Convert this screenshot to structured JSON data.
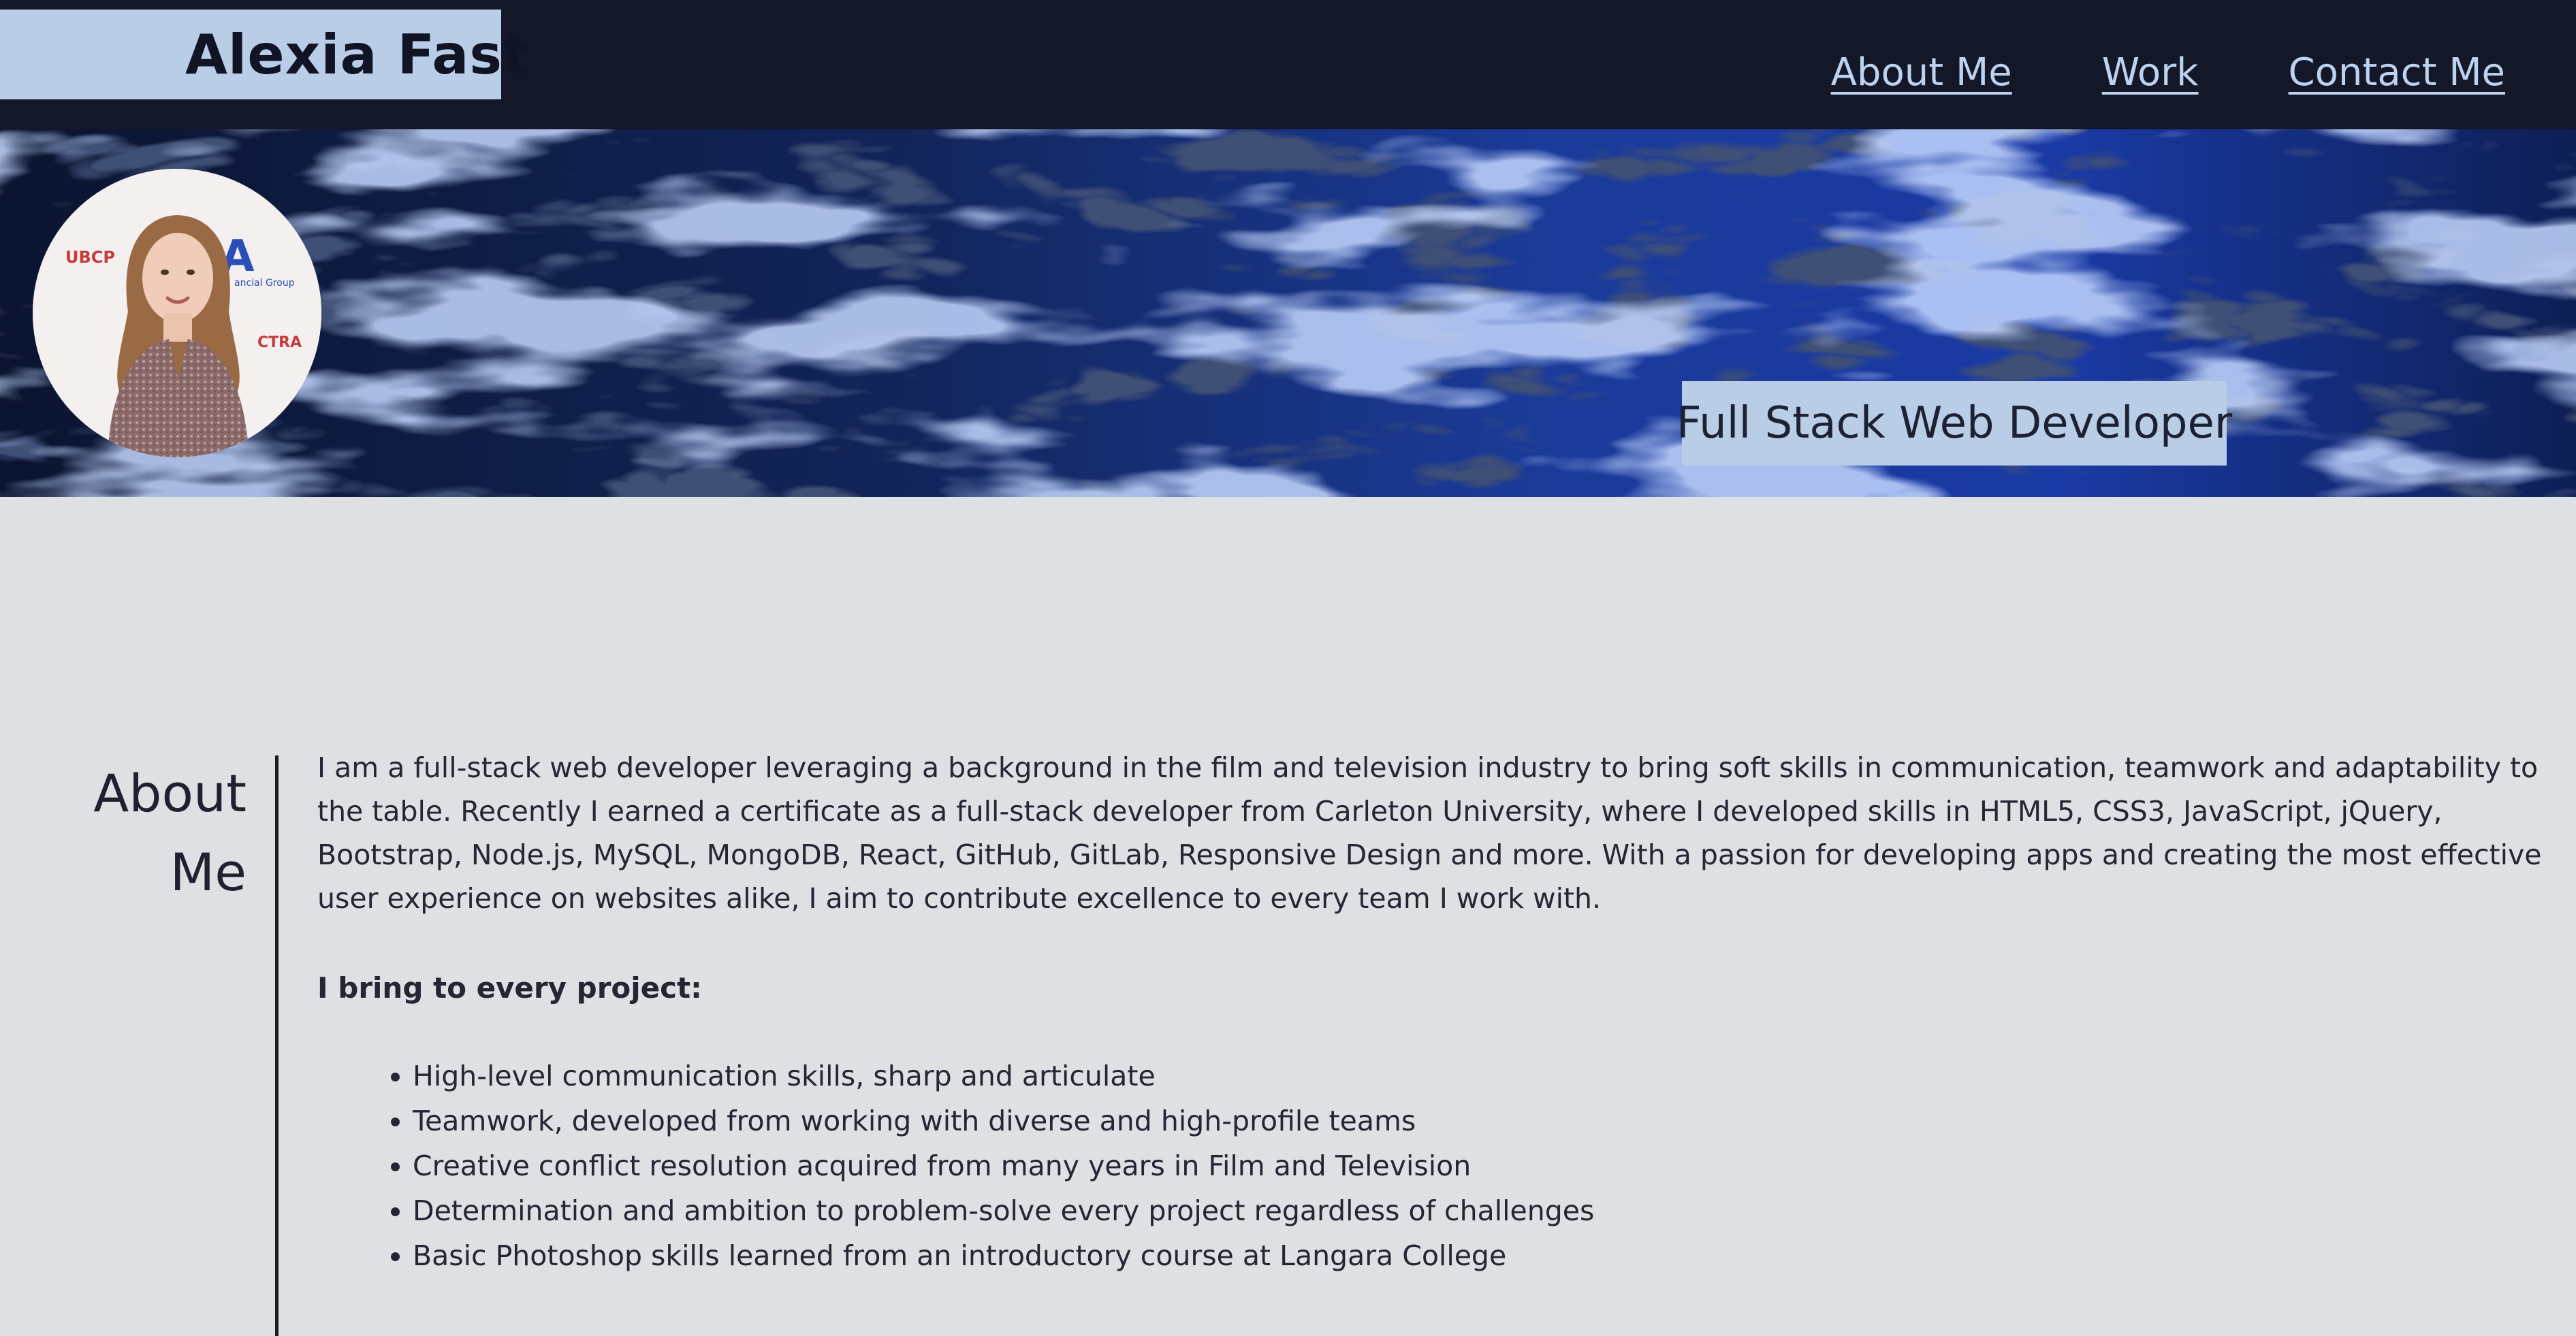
{
  "header": {
    "brand": "Alexia Fast",
    "nav": [
      {
        "label": "About Me"
      },
      {
        "label": "Work"
      },
      {
        "label": "Contact Me"
      }
    ]
  },
  "hero": {
    "tagline": "Full Stack Web Developer",
    "avatar_backdrop": [
      "UBCP",
      "A",
      "ancial Group",
      "CTRA"
    ]
  },
  "about": {
    "heading_line1": "About",
    "heading_line2": "Me",
    "paragraph": "I am a full-stack web developer leveraging a background in the film and television industry to bring soft skills in communication, teamwork and adaptability to the table. Recently I earned a certificate as a full-stack developer from Carleton University, where I developed skills in HTML5, CSS3, JavaScript, jQuery, Bootstrap, Node.js, MySQL, MongoDB, React, GitHub, GitLab, Responsive Design and more. With a passion for developing apps and creating the most effective user experience on websites alike, I aim to contribute excellence to every team I work with.",
    "bring_heading": "I bring to every project:",
    "bring_items": [
      "High-level communication skills, sharp and articulate",
      "Teamwork, developed from working with diverse and high-profile teams",
      "Creative conflict resolution acquired from many years in Film and Television",
      "Determination and ambition to problem-solve every project regardless of challenges",
      "Basic Photoshop skills learned from an introductory course at Langara College"
    ]
  },
  "colors": {
    "header_bg": "#131728",
    "accent_box": "#b9cde6",
    "nav_link": "#bdd2ee",
    "page_bg": "#dde1e4",
    "hero_blue": "#2a5bd8"
  }
}
